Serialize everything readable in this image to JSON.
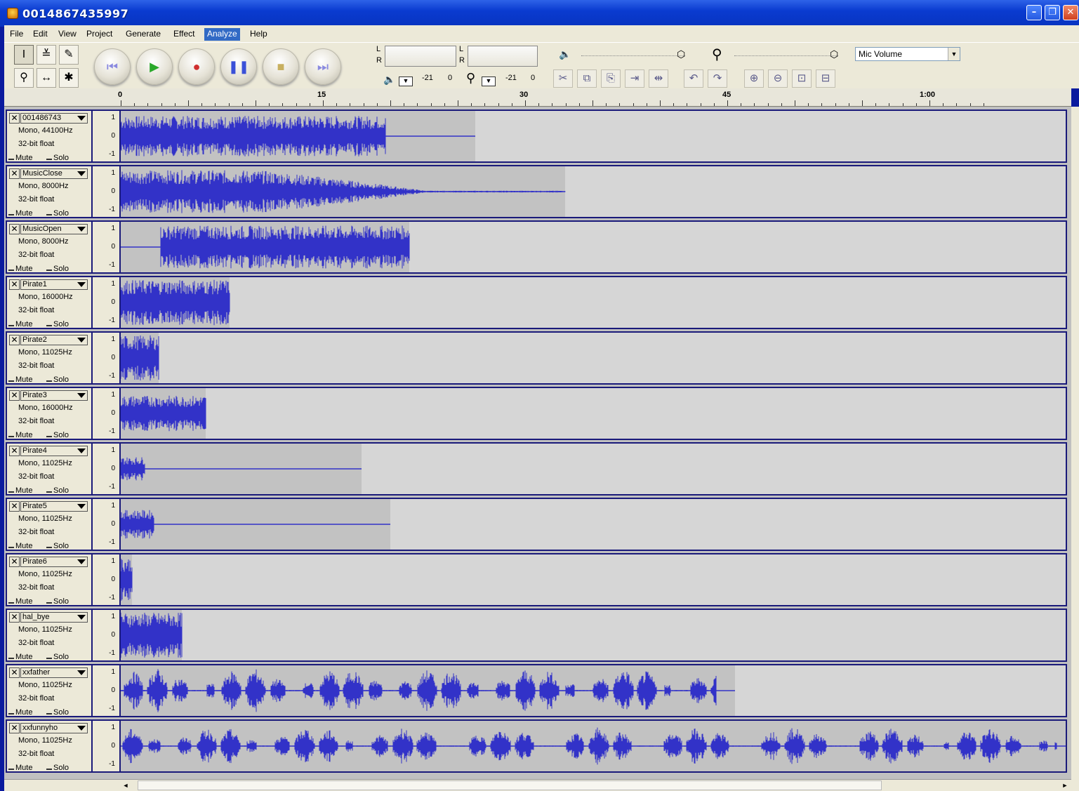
{
  "window": {
    "title": "0014867435997"
  },
  "menu": [
    "File",
    "Edit",
    "View",
    "Project",
    "Generate",
    "Effect",
    "Analyze",
    "Help"
  ],
  "menu_active": "Analyze",
  "toolbar": {
    "meter_play_label": "L R",
    "meter_min": "-21",
    "meter_zero": "0",
    "mix_input_source": "Mic Volume"
  },
  "ruler": {
    "labels": [
      "0",
      "15",
      "30",
      "45",
      "1:00"
    ]
  },
  "vruler_labels": [
    "1",
    "0",
    "-1"
  ],
  "track_buttons": {
    "mute": "Mute",
    "solo": "Solo"
  },
  "colors": {
    "waveform": "#3232c8",
    "clip_bg": "#c2c2c2",
    "track_bg": "#d6d6d6",
    "desktop": "#0a1a9e"
  },
  "tracks": [
    {
      "name": "001486743",
      "rate": "Mono, 44100Hz",
      "format": "32-bit float",
      "clip_end": 0.375,
      "wave_end": 0.28,
      "amp": 0.85
    },
    {
      "name": "MusicClose",
      "rate": "Mono, 8000Hz",
      "format": "32-bit float",
      "clip_end": 0.47,
      "wave_end": 0.47,
      "amp": 0.9,
      "fade": true
    },
    {
      "name": "MusicOpen",
      "rate": "Mono, 8000Hz",
      "format": "32-bit float",
      "clip_end": 0.305,
      "wave_start": 0.042,
      "wave_end": 0.305,
      "amp": 0.9
    },
    {
      "name": "Pirate1",
      "rate": "Mono, 16000Hz",
      "format": "32-bit float",
      "clip_end": 0.115,
      "wave_end": 0.115,
      "amp": 0.95
    },
    {
      "name": "Pirate2",
      "rate": "Mono, 11025Hz",
      "format": "32-bit float",
      "clip_end": 0.04,
      "wave_end": 0.04,
      "amp": 0.95
    },
    {
      "name": "Pirate3",
      "rate": "Mono, 16000Hz",
      "format": "32-bit float",
      "clip_end": 0.09,
      "wave_end": 0.09,
      "amp": 0.75
    },
    {
      "name": "Pirate4",
      "rate": "Mono, 11025Hz",
      "format": "32-bit float",
      "clip_end": 0.255,
      "wave_end": 0.025,
      "amp": 0.5
    },
    {
      "name": "Pirate5",
      "rate": "Mono, 11025Hz",
      "format": "32-bit float",
      "clip_end": 0.285,
      "wave_end": 0.035,
      "amp": 0.6
    },
    {
      "name": "Pirate6",
      "rate": "Mono, 11025Hz",
      "format": "32-bit float",
      "clip_end": 0.012,
      "wave_end": 0.012,
      "amp": 0.95
    },
    {
      "name": "hal_bye",
      "rate": "Mono, 11025Hz",
      "format": "32-bit float",
      "clip_end": 0.065,
      "wave_end": 0.065,
      "amp": 0.95
    },
    {
      "name": "xxfather",
      "rate": "Mono, 11025Hz",
      "format": "32-bit float",
      "clip_end": 0.65,
      "wave_end": 0.63,
      "amp": 0.95,
      "bursty": true
    },
    {
      "name": "xxfunnyho",
      "rate": "Mono, 11025Hz",
      "format": "32-bit float",
      "clip_end": 1.0,
      "wave_end": 0.99,
      "amp": 0.8,
      "bursty": true
    }
  ]
}
